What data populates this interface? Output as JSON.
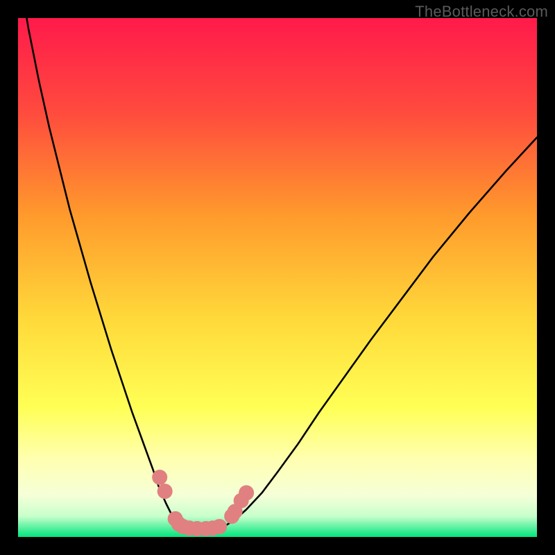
{
  "watermark": "TheBottleneck.com",
  "colors": {
    "frame": "#000000",
    "gradient_top": "#ff1a4b",
    "gradient_mid1": "#ff7a2e",
    "gradient_mid2": "#ffe73f",
    "gradient_low1": "#ffffb0",
    "gradient_low2": "#e8ffd0",
    "gradient_bottom": "#00e67d",
    "curve": "#000000",
    "marker": "#e08080"
  },
  "chart_data": {
    "type": "line",
    "title": "",
    "xlabel": "",
    "ylabel": "",
    "xlim": [
      0,
      100
    ],
    "ylim": [
      0,
      100
    ],
    "series": [
      {
        "name": "bottleneck-curve",
        "x": [
          0,
          2,
          4,
          6,
          8,
          10,
          12,
          14,
          16,
          18,
          20,
          22,
          24,
          26,
          27,
          28.5,
          30,
          31,
          32,
          33,
          34,
          36,
          38,
          40,
          42,
          44,
          47,
          50,
          54,
          58,
          63,
          68,
          74,
          80,
          87,
          94,
          100
        ],
        "values": [
          110,
          98,
          88,
          79,
          71,
          63,
          56,
          49,
          42.5,
          36,
          30,
          24,
          18.5,
          13,
          10,
          6.5,
          3.5,
          2.2,
          1.5,
          1.2,
          1.2,
          1.3,
          1.5,
          2.2,
          3.5,
          5.3,
          8.5,
          12.5,
          18,
          24,
          31,
          38,
          46,
          54,
          62.5,
          70.5,
          77
        ]
      }
    ],
    "markers": {
      "name": "highlighted-points",
      "color": "#e08080",
      "points": [
        {
          "x": 27.3,
          "y": 11.5
        },
        {
          "x": 28.3,
          "y": 8.8
        },
        {
          "x": 30.3,
          "y": 3.5
        },
        {
          "x": 31.0,
          "y": 2.5
        },
        {
          "x": 31.8,
          "y": 2.0
        },
        {
          "x": 33.0,
          "y": 1.7
        },
        {
          "x": 34.5,
          "y": 1.6
        },
        {
          "x": 36.2,
          "y": 1.6
        },
        {
          "x": 37.5,
          "y": 1.7
        },
        {
          "x": 38.8,
          "y": 2.0
        },
        {
          "x": 41.2,
          "y": 4.0
        },
        {
          "x": 41.8,
          "y": 4.9
        },
        {
          "x": 43.0,
          "y": 7.0
        },
        {
          "x": 44.0,
          "y": 8.5
        }
      ]
    }
  }
}
